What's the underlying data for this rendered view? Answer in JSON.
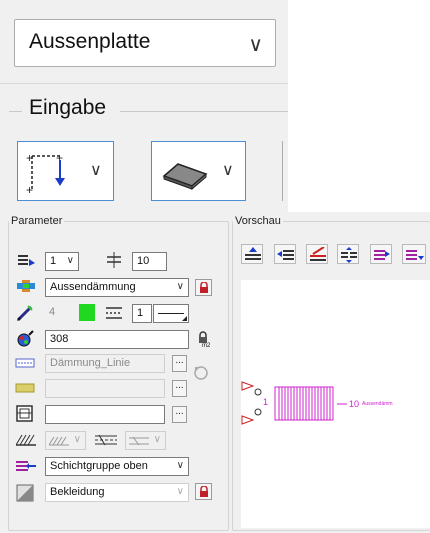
{
  "top": {
    "dropdown_value": "Aussenplatte",
    "section_label": "Eingabe"
  },
  "params": {
    "legend": "Parameter",
    "layer_select": "1",
    "spacing_value": "10",
    "material_select": "Aussendämmung",
    "pen_value": "4",
    "linetype_value": "1",
    "number_value": "308",
    "line_name": "Dämmung_Linie",
    "group_select": "Schichtgruppe oben",
    "cover_select": "Bekleidung",
    "accent_color": "#1fd81f",
    "lock_color": "#c0202a"
  },
  "vorschau": {
    "legend": "Vorschau",
    "label_left": "1",
    "label_right": "10",
    "label_right_text": "Aussendämm",
    "preview_color": "#cc22cc"
  }
}
